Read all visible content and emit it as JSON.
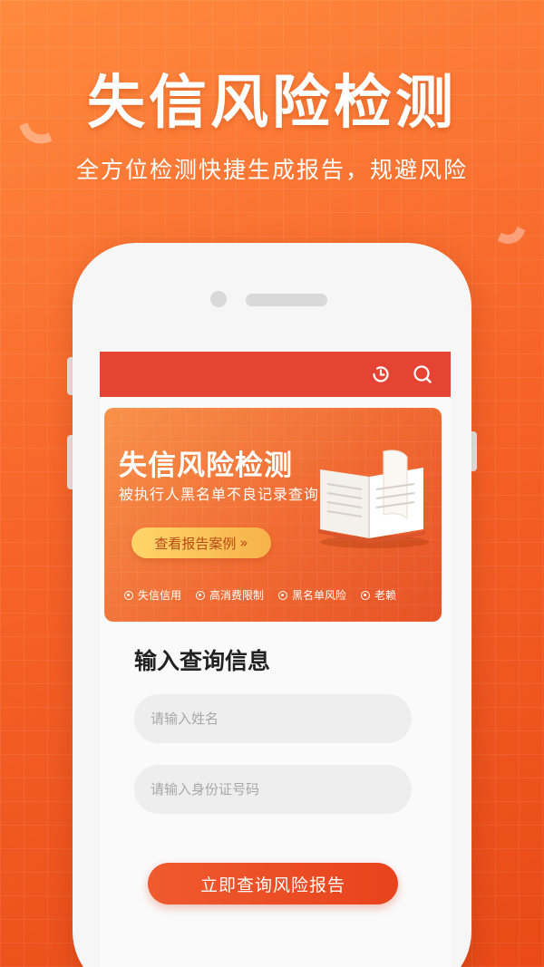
{
  "hero": {
    "title": "失信风险检测",
    "subtitle": "全方位检测快捷生成报告，规避风险"
  },
  "app_bar": {
    "color": "#e54434",
    "icons": [
      "history-clock-icon",
      "search-icon"
    ]
  },
  "banner": {
    "title": "失信风险检测",
    "subtitle": "被执行人黑名单不良记录查询",
    "case_button": "查看报告案例",
    "case_button_arrow": "»",
    "tags": [
      "失信信用",
      "高消费限制",
      "黑名单风险",
      "老赖"
    ]
  },
  "form": {
    "title": "输入查询信息",
    "name_placeholder": "请输入姓名",
    "id_placeholder": "请输入身份证号码",
    "submit_label": "立即查询风险报告"
  },
  "colors": {
    "accent": "#f06a32",
    "app_bar": "#e54434",
    "button": "#e8431c"
  }
}
